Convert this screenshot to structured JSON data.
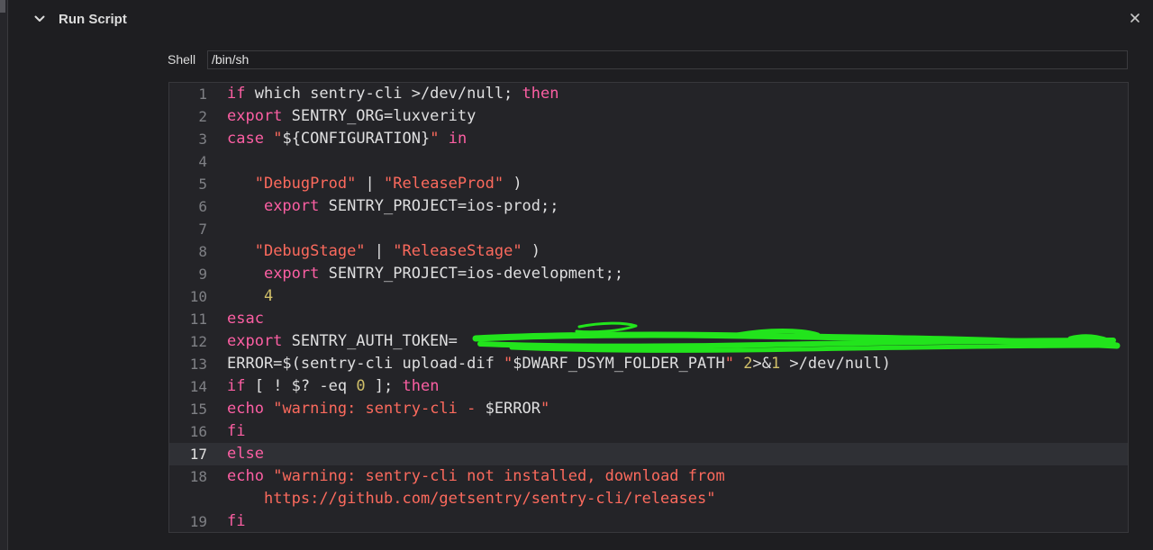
{
  "phase": {
    "title": "Run Script"
  },
  "shell": {
    "label": "Shell",
    "value": "/bin/sh"
  },
  "icons": {
    "disclosure": "chevron-down-icon",
    "close": "close-icon"
  },
  "colors": {
    "keyword": "#fc5fa3",
    "string": "#fc6a5d",
    "number": "#d0bf69",
    "plain": "#dfdfe0",
    "redaction": "#22e41c"
  },
  "editor": {
    "current_line": 17,
    "lines": [
      {
        "number": "1",
        "tokens": [
          {
            "t": "if",
            "c": "kw"
          },
          {
            "t": " which sentry-cli >/dev/null; "
          },
          {
            "t": "then",
            "c": "kw"
          }
        ]
      },
      {
        "number": "2",
        "tokens": [
          {
            "t": "export",
            "c": "kw"
          },
          {
            "t": " SENTRY_ORG=luxverity"
          }
        ]
      },
      {
        "number": "3",
        "tokens": [
          {
            "t": "case",
            "c": "kw"
          },
          {
            "t": " "
          },
          {
            "t": "\"",
            "c": "str"
          },
          {
            "t": "${CONFIGURATION}"
          },
          {
            "t": "\"",
            "c": "str"
          },
          {
            "t": " "
          },
          {
            "t": "in",
            "c": "kw"
          }
        ]
      },
      {
        "number": "4",
        "tokens": []
      },
      {
        "number": "5",
        "tokens": [
          {
            "t": "   "
          },
          {
            "t": "\"DebugProd\"",
            "c": "str"
          },
          {
            "t": " | "
          },
          {
            "t": "\"ReleaseProd\"",
            "c": "str"
          },
          {
            "t": " )"
          }
        ]
      },
      {
        "number": "6",
        "tokens": [
          {
            "t": "    "
          },
          {
            "t": "export",
            "c": "kw"
          },
          {
            "t": " SENTRY_PROJECT=ios-prod;;"
          }
        ]
      },
      {
        "number": "7",
        "tokens": []
      },
      {
        "number": "8",
        "tokens": [
          {
            "t": "   "
          },
          {
            "t": "\"DebugStage\"",
            "c": "str"
          },
          {
            "t": " | "
          },
          {
            "t": "\"ReleaseStage\"",
            "c": "str"
          },
          {
            "t": " )"
          }
        ]
      },
      {
        "number": "9",
        "tokens": [
          {
            "t": "    "
          },
          {
            "t": "export",
            "c": "kw"
          },
          {
            "t": " SENTRY_PROJECT=ios-development;;"
          }
        ]
      },
      {
        "number": "10",
        "tokens": [
          {
            "t": "    "
          },
          {
            "t": "4",
            "c": "num"
          }
        ]
      },
      {
        "number": "11",
        "tokens": [
          {
            "t": "esac",
            "c": "kw"
          }
        ]
      },
      {
        "number": "12",
        "tokens": [
          {
            "t": "export",
            "c": "kw"
          },
          {
            "t": " SENTRY_AUTH_TOKEN="
          }
        ]
      },
      {
        "number": "13",
        "tokens": [
          {
            "t": "ERROR=$(sentry-cli upload-dif "
          },
          {
            "t": "\"",
            "c": "str"
          },
          {
            "t": "$DWARF_DSYM_FOLDER_PATH"
          },
          {
            "t": "\"",
            "c": "str"
          },
          {
            "t": " "
          },
          {
            "t": "2",
            "c": "num"
          },
          {
            "t": ">&"
          },
          {
            "t": "1",
            "c": "num"
          },
          {
            "t": " >/dev/null)"
          }
        ]
      },
      {
        "number": "14",
        "tokens": [
          {
            "t": "if",
            "c": "kw"
          },
          {
            "t": " [ ! $? -eq "
          },
          {
            "t": "0",
            "c": "num"
          },
          {
            "t": " ]; "
          },
          {
            "t": "then",
            "c": "kw"
          }
        ]
      },
      {
        "number": "15",
        "tokens": [
          {
            "t": "echo",
            "c": "kw"
          },
          {
            "t": " "
          },
          {
            "t": "\"warning: sentry-cli - ",
            "c": "str"
          },
          {
            "t": "$ERROR"
          },
          {
            "t": "\"",
            "c": "str"
          }
        ]
      },
      {
        "number": "16",
        "tokens": [
          {
            "t": "fi",
            "c": "kw"
          }
        ]
      },
      {
        "number": "17",
        "tokens": [
          {
            "t": "else",
            "c": "kw"
          }
        ]
      },
      {
        "number": "18",
        "tokens": [
          {
            "t": "echo",
            "c": "kw"
          },
          {
            "t": " "
          },
          {
            "t": "\"warning: sentry-cli not installed, download from",
            "c": "str"
          }
        ]
      },
      {
        "number": "",
        "tokens": [
          {
            "t": "    "
          },
          {
            "t": "https://github.com/getsentry/sentry-cli/releases\"",
            "c": "str"
          }
        ]
      },
      {
        "number": "19",
        "tokens": [
          {
            "t": "fi",
            "c": "kw"
          }
        ]
      }
    ]
  }
}
